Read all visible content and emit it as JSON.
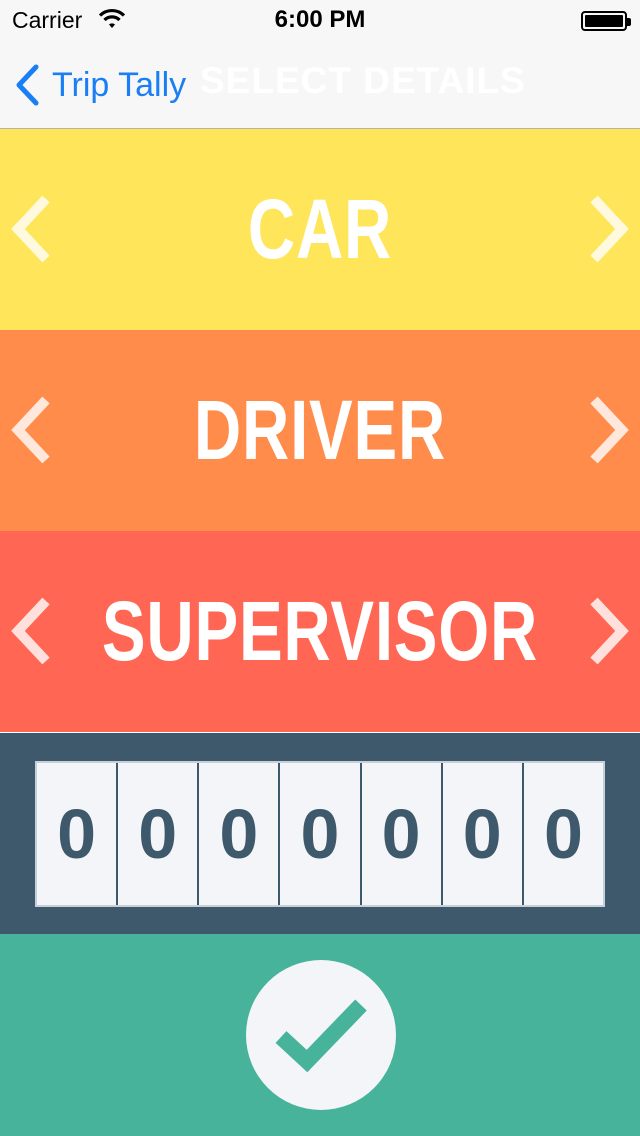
{
  "status_bar": {
    "carrier": "Carrier",
    "time": "6:00 PM"
  },
  "nav": {
    "back_label": "Trip Tally",
    "title": "SELECT DETAILS"
  },
  "rows": [
    {
      "label": "CAR",
      "color": "#ffe55a"
    },
    {
      "label": "DRIVER",
      "color": "#ff8c4a"
    },
    {
      "label": "SUPERVISOR",
      "color": "#ff6654"
    }
  ],
  "counter": {
    "digits": [
      "0",
      "0",
      "0",
      "0",
      "0",
      "0",
      "0"
    ],
    "color": "#3d596b"
  },
  "confirm": {
    "icon": "checkmark-icon",
    "color": "#47b39b"
  },
  "colors": {
    "accent_blue": "#1a7ef5",
    "nav_background": "#f7f7f7"
  }
}
